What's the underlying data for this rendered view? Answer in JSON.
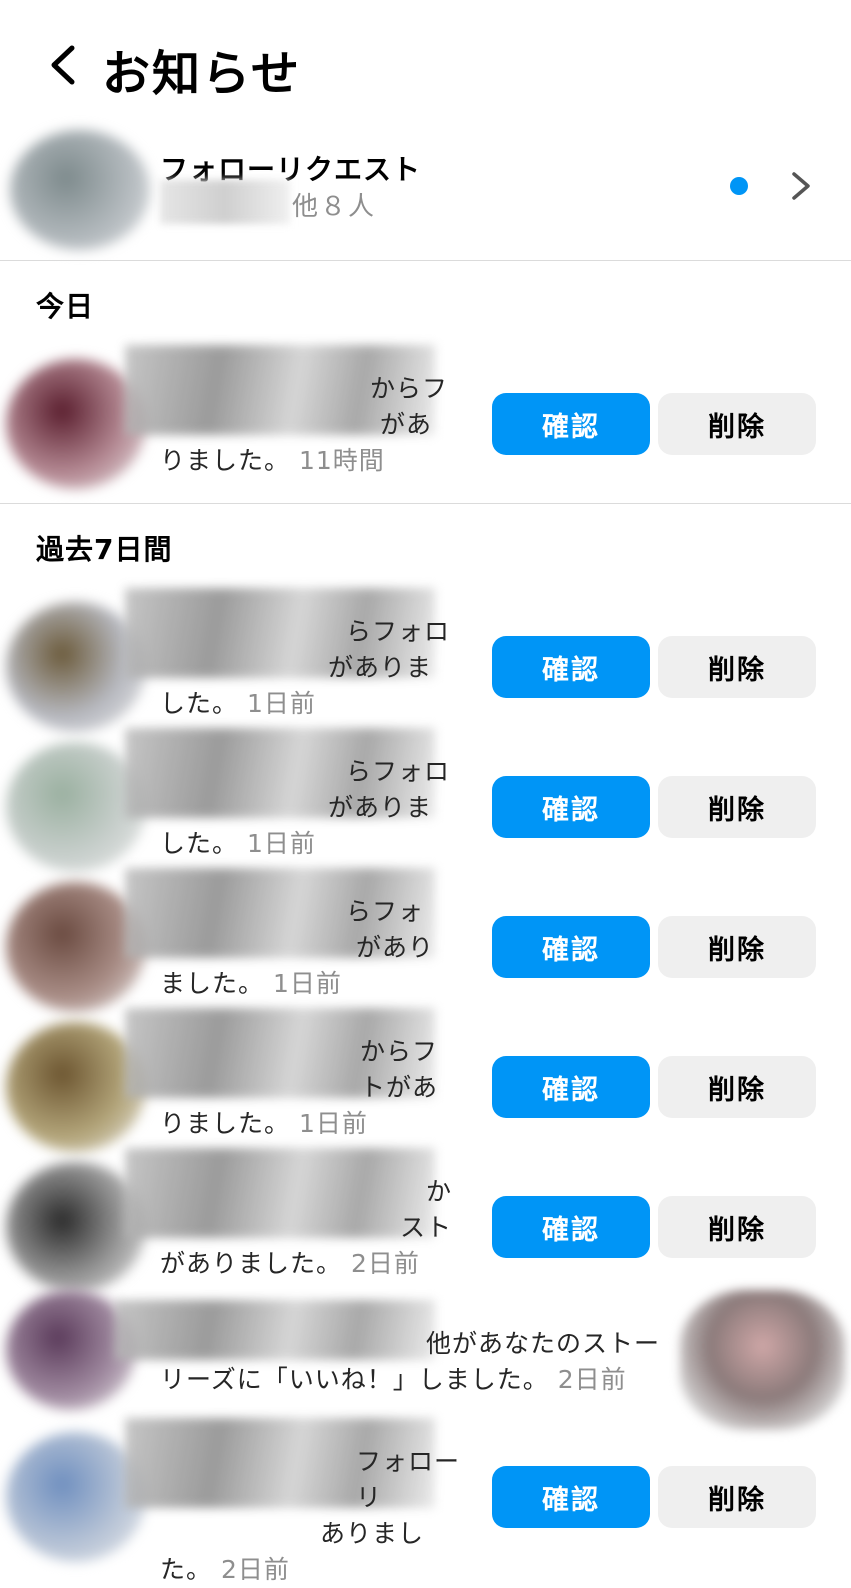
{
  "header": {
    "title": "お知らせ",
    "back_icon": "chevron-left-icon"
  },
  "follow_requests": {
    "title": "フォローリクエスト",
    "subtitle": "他８人",
    "unread_color": "#0095f6",
    "chevron_icon": "chevron-right-icon"
  },
  "sections": {
    "today": "今日",
    "past7": "過去7日間"
  },
  "buttons": {
    "confirm": "確認",
    "delete": "削除"
  },
  "today_items": [
    {
      "line1": "からフ",
      "line2": "があ",
      "line3": "りました。",
      "time": "11時間"
    }
  ],
  "past_items": [
    {
      "line1": "らフォロ",
      "line2": "がありま",
      "line3": "した。",
      "time": "1日前"
    },
    {
      "line1": "らフォロ",
      "line2": "がありま",
      "line3": "した。",
      "time": "1日前"
    },
    {
      "line1": "らフォ",
      "line2": "があり",
      "line3": "ました。",
      "time": "1日前"
    },
    {
      "line1": "からフ",
      "line2": "トがあ",
      "line3": "りました。",
      "time": "1日前"
    },
    {
      "line1": "か",
      "line2": "スト",
      "line3": "がありました。",
      "time": "2日前"
    }
  ],
  "story_item": {
    "line1": "他があなたのストー",
    "line2": "リーズに「いいね！」しました。",
    "time": "2日前"
  },
  "last_item": {
    "line1": "フォローリ",
    "line2": "ありまし",
    "line3": "た。",
    "time": "2日前"
  },
  "colors": {
    "accent": "#0095f6",
    "secondary_button": "#efefef",
    "muted_text": "#8e8e8e"
  }
}
